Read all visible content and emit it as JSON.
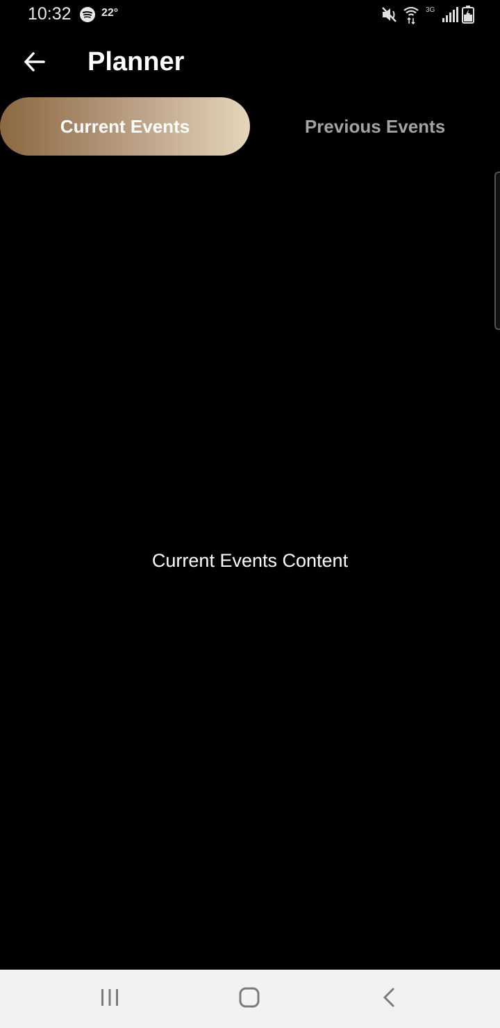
{
  "status_bar": {
    "time": "10:32",
    "temperature": "22°",
    "network_type": "3G",
    "icons": [
      "spotify-icon",
      "mute-icon",
      "wifi-icon",
      "signal-icon",
      "battery-icon"
    ]
  },
  "header": {
    "title": "Planner",
    "back_icon": "arrow-left-icon"
  },
  "tabs": [
    {
      "label": "Current Events",
      "selected": true
    },
    {
      "label": "Previous Events",
      "selected": false
    }
  ],
  "main": {
    "content_text": "Current Events Content"
  },
  "nav_bar": {
    "icons": [
      "recents-icon",
      "home-icon",
      "back-icon"
    ]
  },
  "colors": {
    "background": "#000000",
    "tab_gradient_start": "#8b6840",
    "tab_gradient_end": "#e5d6bb",
    "inactive_tab_text": "#a3a3a3",
    "nav_bar_background": "#f2f2f2"
  }
}
